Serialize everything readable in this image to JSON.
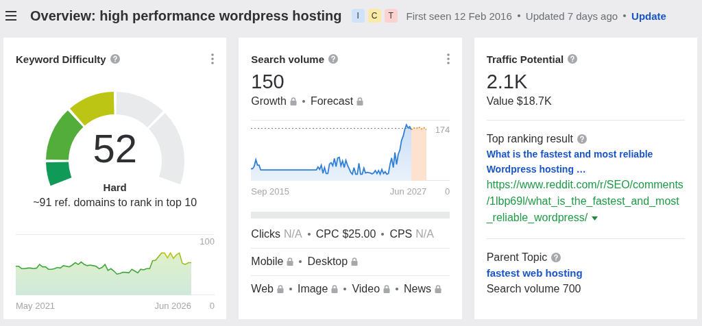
{
  "header": {
    "title": "Overview: high performance wordpress hosting",
    "intents": [
      {
        "label": "I",
        "color": "#cfe2fa"
      },
      {
        "label": "C",
        "color": "#fbeaa6"
      },
      {
        "label": "T",
        "color": "#fbd2d0"
      }
    ],
    "first_seen": "First seen 12 Feb 2016",
    "updated": "Updated 7 days ago",
    "update_link": "Update"
  },
  "keyword_difficulty": {
    "title": "Keyword Difficulty",
    "score": "52",
    "rating": "Hard",
    "note": "~91 ref. domains to rank in top 10",
    "chart": {
      "start_label": "May 2021",
      "end_label": "Jun 2026",
      "y_max": "100",
      "y_min": "0"
    }
  },
  "search_volume": {
    "title": "Search volume",
    "value": "150",
    "trends": [
      {
        "label": "Growth",
        "locked": true
      },
      {
        "label": "Forecast",
        "locked": true
      }
    ],
    "chart": {
      "start_label": "Sep 2015",
      "end_label": "Jun 2027",
      "y_max": "174",
      "y_min": "0"
    },
    "cost_metrics": [
      {
        "label": "Clicks",
        "value": "N/A",
        "muted": true
      },
      {
        "label": "CPC",
        "value": "$25.00",
        "muted": false
      },
      {
        "label": "CPS",
        "value": "N/A",
        "muted": true
      }
    ],
    "devices": [
      {
        "label": "Mobile",
        "locked": true
      },
      {
        "label": "Desktop",
        "locked": true
      }
    ],
    "serp_types": [
      {
        "label": "Web",
        "locked": true
      },
      {
        "label": "Image",
        "locked": true
      },
      {
        "label": "Video",
        "locked": true
      },
      {
        "label": "News",
        "locked": true
      }
    ]
  },
  "traffic_potential": {
    "title": "Traffic Potential",
    "value": "2.1K",
    "worth": "Value $18.7K",
    "top_result": {
      "label": "Top ranking result",
      "title": "What is the fastest and most reliable Wordpress hosting …",
      "url": "https://www.reddit.com/r/SEO/comments/1lbp69l/what_is_the_fastest_and_most_reliable_wordpress/"
    },
    "parent_topic": {
      "label": "Parent Topic",
      "topic": "fastest web hosting",
      "volume": "Search volume 700"
    }
  }
}
